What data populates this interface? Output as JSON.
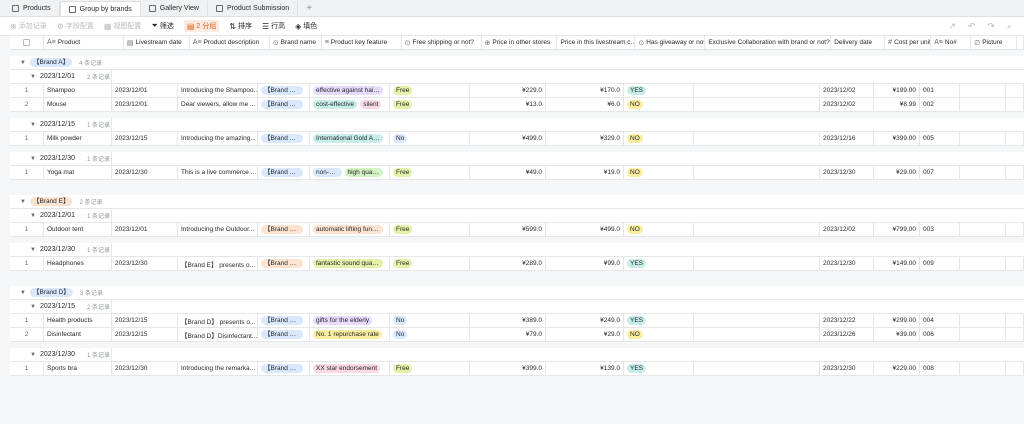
{
  "tabs": [
    {
      "label": "Products",
      "active": false
    },
    {
      "label": "Group by brands",
      "active": true
    },
    {
      "label": "Gallery View",
      "active": false
    },
    {
      "label": "Product Submission",
      "active": false
    }
  ],
  "toolbar": {
    "add_record": "添加记录",
    "insert_config": "字段配置",
    "view_config": "视图配置",
    "filter": "筛选",
    "group": "2 分组",
    "sort": "排序",
    "row_height": "行高",
    "fill": "填色"
  },
  "columns": [
    "Product",
    "Livestream date",
    "Product description",
    "Brand name",
    "Product key feature",
    "Free shipping or not?",
    "Price in other stores",
    "Price in this livestream c...",
    "Has giveaway or not?",
    "Exclusive Collaboration with brand or not?",
    "Delivery date",
    "Cost per unit",
    "No#",
    "Picture"
  ],
  "groups": [
    {
      "brand": "【Brand A】",
      "brand_color": "blue",
      "count": "4 条记录",
      "subgroups": [
        {
          "date": "2023/12/01",
          "count": "2 条记录",
          "rows": [
            {
              "idx": "1",
              "product": "Shampoo",
              "date": "2023/12/01",
              "desc": "Introducing the Shampoo...",
              "brand": "【Brand A】",
              "features": [
                {
                  "t": "effective against hair l...",
                  "c": "purple"
                }
              ],
              "shipping": "Free",
              "price_other": "¥229.0",
              "price_live": "¥170.0",
              "giveaway": "YES",
              "delivery": "2023/12/02",
              "cost": "¥199.00",
              "no": "001"
            },
            {
              "idx": "2",
              "product": "Mouse",
              "date": "2023/12/01",
              "desc": "Dear viewers, allow me ...",
              "brand": "【Brand A】",
              "features": [
                {
                  "t": "cost-effective",
                  "c": "teal"
                },
                {
                  "t": "silent",
                  "c": "pink"
                }
              ],
              "shipping": "Free",
              "price_other": "¥13.0",
              "price_live": "¥6.0",
              "giveaway": "NO",
              "delivery": "2023/12/02",
              "cost": "¥8.99",
              "no": "002"
            }
          ]
        },
        {
          "date": "2023/12/15",
          "count": "1 条记录",
          "rows": [
            {
              "idx": "1",
              "product": "Milk powder",
              "date": "2023/12/15",
              "desc": "Introducing the amazing...",
              "brand": "【Brand A】",
              "features": [
                {
                  "t": "International Gold Aw...",
                  "c": "teal"
                }
              ],
              "shipping": "No",
              "price_other": "¥499.0",
              "price_live": "¥329.0",
              "giveaway": "NO",
              "delivery": "2023/12/16",
              "cost": "¥399.00",
              "no": "005"
            }
          ]
        },
        {
          "date": "2023/12/30",
          "count": "1 条记录",
          "rows": [
            {
              "idx": "1",
              "product": "Yoga mat",
              "date": "2023/12/30",
              "desc": "This is a live commerce ...",
              "brand": "【Brand A】",
              "features": [
                {
                  "t": "non-slip",
                  "c": "blue"
                },
                {
                  "t": "high quality",
                  "c": "green"
                }
              ],
              "shipping": "Free",
              "price_other": "¥49.0",
              "price_live": "¥19.0",
              "giveaway": "NO",
              "delivery": "2023/12/30",
              "cost": "¥29.00",
              "no": "007"
            }
          ]
        }
      ]
    },
    {
      "brand": "【Brand E】",
      "brand_color": "orange",
      "count": "2 条记录",
      "subgroups": [
        {
          "date": "2023/12/01",
          "count": "1 条记录",
          "rows": [
            {
              "idx": "1",
              "product": "Outdoor tent",
              "date": "2023/12/01",
              "desc": "Introducing the Outdoor...",
              "brand": "【Brand E】",
              "features": [
                {
                  "t": "automatic lifting functi...",
                  "c": "orange"
                }
              ],
              "shipping": "Free",
              "price_other": "¥599.0",
              "price_live": "¥499.0",
              "giveaway": "NO",
              "delivery": "2023/12/02",
              "cost": "¥799.00",
              "no": "003"
            }
          ]
        },
        {
          "date": "2023/12/30",
          "count": "1 条记录",
          "rows": [
            {
              "idx": "1",
              "product": "Headphones",
              "date": "2023/12/30",
              "desc": "【Brand E】 presents o...",
              "brand": "【Brand E】",
              "features": [
                {
                  "t": "fantastic sound quality",
                  "c": "lime"
                }
              ],
              "shipping": "Free",
              "price_other": "¥289.0",
              "price_live": "¥99.0",
              "giveaway": "YES",
              "delivery": "2023/12/30",
              "cost": "¥149.00",
              "no": "009"
            }
          ]
        }
      ]
    },
    {
      "brand": "【Brand D】",
      "brand_color": "blue",
      "count": "3 条记录",
      "subgroups": [
        {
          "date": "2023/12/15",
          "count": "2 条记录",
          "rows": [
            {
              "idx": "1",
              "product": "Health products",
              "date": "2023/12/15",
              "desc": "【Brand D】 presents o...",
              "brand": "【Brand D】",
              "features": [
                {
                  "t": "gifts for the elderly",
                  "c": "purple"
                }
              ],
              "shipping": "No",
              "price_other": "¥389.0",
              "price_live": "¥249.0",
              "giveaway": "YES",
              "delivery": "2023/12/22",
              "cost": "¥299.00",
              "no": "004"
            },
            {
              "idx": "2",
              "product": "Disinfectant",
              "date": "2023/12/15",
              "desc": "【Brand D】Disinfectant...",
              "brand": "【Brand D】",
              "features": [
                {
                  "t": "No. 1 repurchase rate",
                  "c": "yellow"
                }
              ],
              "shipping": "No",
              "price_other": "¥79.0",
              "price_live": "¥29.0",
              "giveaway": "NO",
              "delivery": "2023/12/26",
              "cost": "¥39.00",
              "no": "006"
            }
          ]
        },
        {
          "date": "2023/12/30",
          "count": "1 条记录",
          "rows": [
            {
              "idx": "1",
              "product": "Sports bra",
              "date": "2023/12/30",
              "desc": "Introducing the remarka...",
              "brand": "【Brand D】",
              "features": [
                {
                  "t": "XX star endorsement",
                  "c": "pink"
                }
              ],
              "shipping": "Free",
              "price_other": "¥399.0",
              "price_live": "¥139.0",
              "giveaway": "YES",
              "delivery": "2023/12/30",
              "cost": "¥229.00",
              "no": "008"
            }
          ]
        }
      ]
    }
  ],
  "colors": {
    "accent": "#e15f12",
    "border": "#dee0e3",
    "background": "#f5f6f7"
  }
}
